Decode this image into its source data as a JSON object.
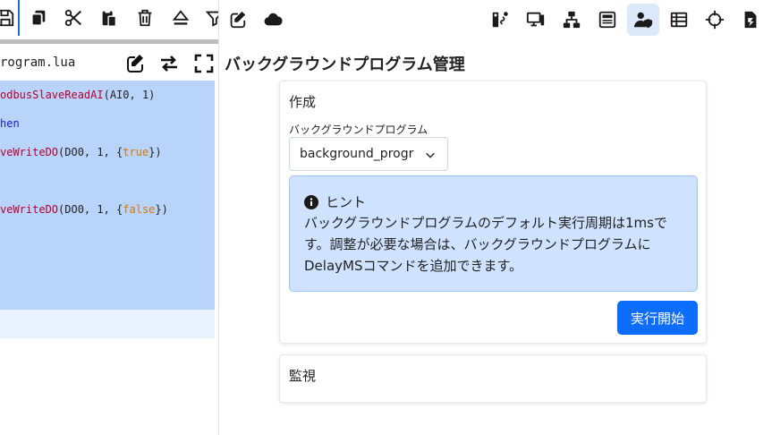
{
  "editor": {
    "file_name": "rogram.lua",
    "code_lines": [
      {
        "parts": [
          {
            "t": "odbusSlaveReadAI",
            "c": "fn"
          },
          {
            "t": "(AI0, 1)",
            "c": ""
          }
        ]
      },
      {
        "parts": [
          {
            "t": "hen",
            "c": "kw"
          }
        ]
      },
      {
        "parts": [
          {
            "t": "veWriteDO",
            "c": "fn"
          },
          {
            "t": "(DO0, 1, {",
            "c": ""
          },
          {
            "t": "true",
            "c": "lit"
          },
          {
            "t": "})",
            "c": ""
          }
        ]
      },
      {
        "parts": []
      },
      {
        "parts": [
          {
            "t": "veWriteDO",
            "c": "fn"
          },
          {
            "t": "(DO0, 1, {",
            "c": ""
          },
          {
            "t": "false",
            "c": "lit"
          },
          {
            "t": "})",
            "c": ""
          }
        ]
      }
    ],
    "toolbar_icons": [
      "save-icon",
      "copy-icon",
      "cut-icon",
      "paste-icon",
      "delete-icon",
      "eject-icon",
      "filter-icon",
      "edit-icon",
      "cloud-icon"
    ],
    "file_bar_icons": [
      "edit-icon",
      "swap-icon",
      "fullscreen-icon"
    ]
  },
  "nav": {
    "icons": [
      "program-s-icon",
      "devices-icon",
      "network-icon",
      "rtu-icon",
      "user-shield-icon",
      "table-icon",
      "crosshair-icon",
      "file-run-icon"
    ],
    "active": "user-shield-icon"
  },
  "page": {
    "title": "バックグラウンドプログラム管理"
  },
  "create_card": {
    "title": "作成",
    "program_label": "バックグラウンドプログラム",
    "program_value": "background_progr",
    "hint_title": "ヒント",
    "hint_body": "バックグラウンドプログラムのデフォルト実行周期は1msです。調整が必要な場合は、バックグラウンドプログラムにDelayMSコマンドを追加できます。",
    "start_label": "実行開始"
  },
  "monitor_card": {
    "title": "監視"
  },
  "colors": {
    "accent": "#0d6efd",
    "hint_bg": "#cfe2ff",
    "code_selection": "#b8d4fb",
    "active_nav_bg": "#dbe9fb"
  }
}
